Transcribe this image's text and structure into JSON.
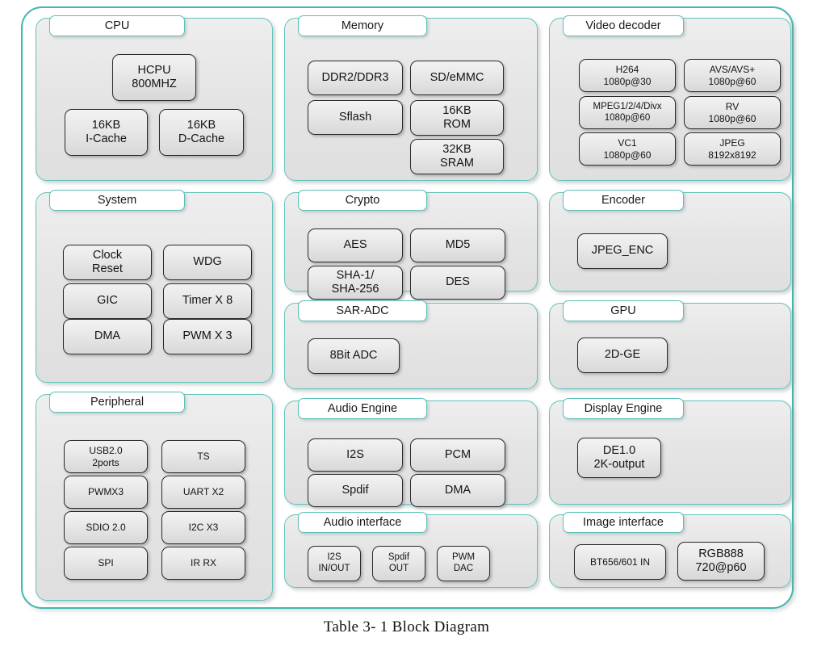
{
  "caption": "Table 3- 1 Block Diagram",
  "colors": {
    "frame_border": "#3fb9ac",
    "panel_border": "#63c3bb",
    "panel_fill": "#e5e5e5",
    "block_border": "#2b2b2b",
    "block_fill": "#e9e9e9",
    "title_fill": "#ffffff",
    "text": "#141414"
  },
  "panels": {
    "cpu": {
      "title": "CPU",
      "blocks": {
        "hcpu": {
          "line1": "HCPU",
          "line2": "800MHZ"
        },
        "icache": {
          "line1": "16KB",
          "line2": "I-Cache"
        },
        "dcache": {
          "line1": "16KB",
          "line2": "D-Cache"
        }
      }
    },
    "system": {
      "title": "System",
      "blocks": {
        "clock": {
          "line1": "Clock",
          "line2": "Reset"
        },
        "wdg": {
          "line1": "WDG",
          "line2": ""
        },
        "gic": {
          "line1": "GIC",
          "line2": ""
        },
        "timer": {
          "line1": "Timer X 8",
          "line2": ""
        },
        "dma": {
          "line1": "DMA",
          "line2": ""
        },
        "pwm": {
          "line1": "PWM X 3",
          "line2": ""
        }
      }
    },
    "peripheral": {
      "title": "Peripheral",
      "blocks": {
        "usb": {
          "line1": "USB2.0",
          "line2": "2ports"
        },
        "ts": {
          "line1": "TS",
          "line2": ""
        },
        "pwm": {
          "line1": "PWMX3",
          "line2": ""
        },
        "uart": {
          "line1": "UART X2",
          "line2": ""
        },
        "sdio": {
          "line1": "SDIO 2.0",
          "line2": ""
        },
        "i2c": {
          "line1": "I2C X3",
          "line2": ""
        },
        "spi": {
          "line1": "SPI",
          "line2": ""
        },
        "ir": {
          "line1": "IR RX",
          "line2": ""
        }
      }
    },
    "memory": {
      "title": "Memory",
      "blocks": {
        "ddr": {
          "line1": "DDR2/DDR3",
          "line2": ""
        },
        "sd": {
          "line1": "SD/eMMC",
          "line2": ""
        },
        "sflash": {
          "line1": "Sflash",
          "line2": ""
        },
        "rom": {
          "line1": "16KB",
          "line2": "ROM"
        },
        "sram": {
          "line1": "32KB",
          "line2": "SRAM"
        }
      }
    },
    "crypto": {
      "title": "Crypto",
      "blocks": {
        "aes": {
          "line1": "AES",
          "line2": ""
        },
        "md5": {
          "line1": "MD5",
          "line2": ""
        },
        "sha": {
          "line1": "SHA-1/",
          "line2": "SHA-256"
        },
        "des": {
          "line1": "DES",
          "line2": ""
        }
      }
    },
    "saradc": {
      "title": "SAR-ADC",
      "blocks": {
        "adc8bit": {
          "line1": "8Bit ADC",
          "line2": ""
        }
      }
    },
    "audioengine": {
      "title": "Audio Engine",
      "blocks": {
        "i2s": {
          "line1": "I2S",
          "line2": ""
        },
        "pcm": {
          "line1": "PCM",
          "line2": ""
        },
        "spdif": {
          "line1": "Spdif",
          "line2": ""
        },
        "dma": {
          "line1": "DMA",
          "line2": ""
        }
      }
    },
    "audiointerface": {
      "title": "Audio interface",
      "blocks": {
        "i2s": {
          "line1": "I2S",
          "line2": "IN/OUT"
        },
        "spdif": {
          "line1": "Spdif",
          "line2": "OUT"
        },
        "pwm": {
          "line1": "PWM",
          "line2": "DAC"
        }
      }
    },
    "videodecoder": {
      "title": "Video decoder",
      "blocks": {
        "h264": {
          "line1": "H264",
          "line2": "1080p@30"
        },
        "avs": {
          "line1": "AVS/AVS+",
          "line2": "1080p@60"
        },
        "mpeg": {
          "line1": "MPEG1/2/4/Divx",
          "line2": "1080p@60"
        },
        "rv": {
          "line1": "RV",
          "line2": "1080p@60"
        },
        "vc1": {
          "line1": "VC1",
          "line2": "1080p@60"
        },
        "jpeg": {
          "line1": "JPEG",
          "line2": "8192x8192"
        }
      }
    },
    "encoder": {
      "title": "Encoder",
      "blocks": {
        "jpegenc": {
          "line1": "JPEG_ENC",
          "line2": ""
        }
      }
    },
    "gpu": {
      "title": "GPU",
      "blocks": {
        "ge2d": {
          "line1": "2D-GE",
          "line2": ""
        }
      }
    },
    "displayengine": {
      "title": "Display Engine",
      "blocks": {
        "de10": {
          "line1": "DE1.0",
          "line2": "2K-output"
        }
      }
    },
    "imageinterface": {
      "title": "Image interface",
      "blocks": {
        "bt656": {
          "line1": "BT656/601 IN",
          "line2": ""
        },
        "rgb": {
          "line1": "RGB888",
          "line2": "720@p60"
        }
      }
    }
  }
}
